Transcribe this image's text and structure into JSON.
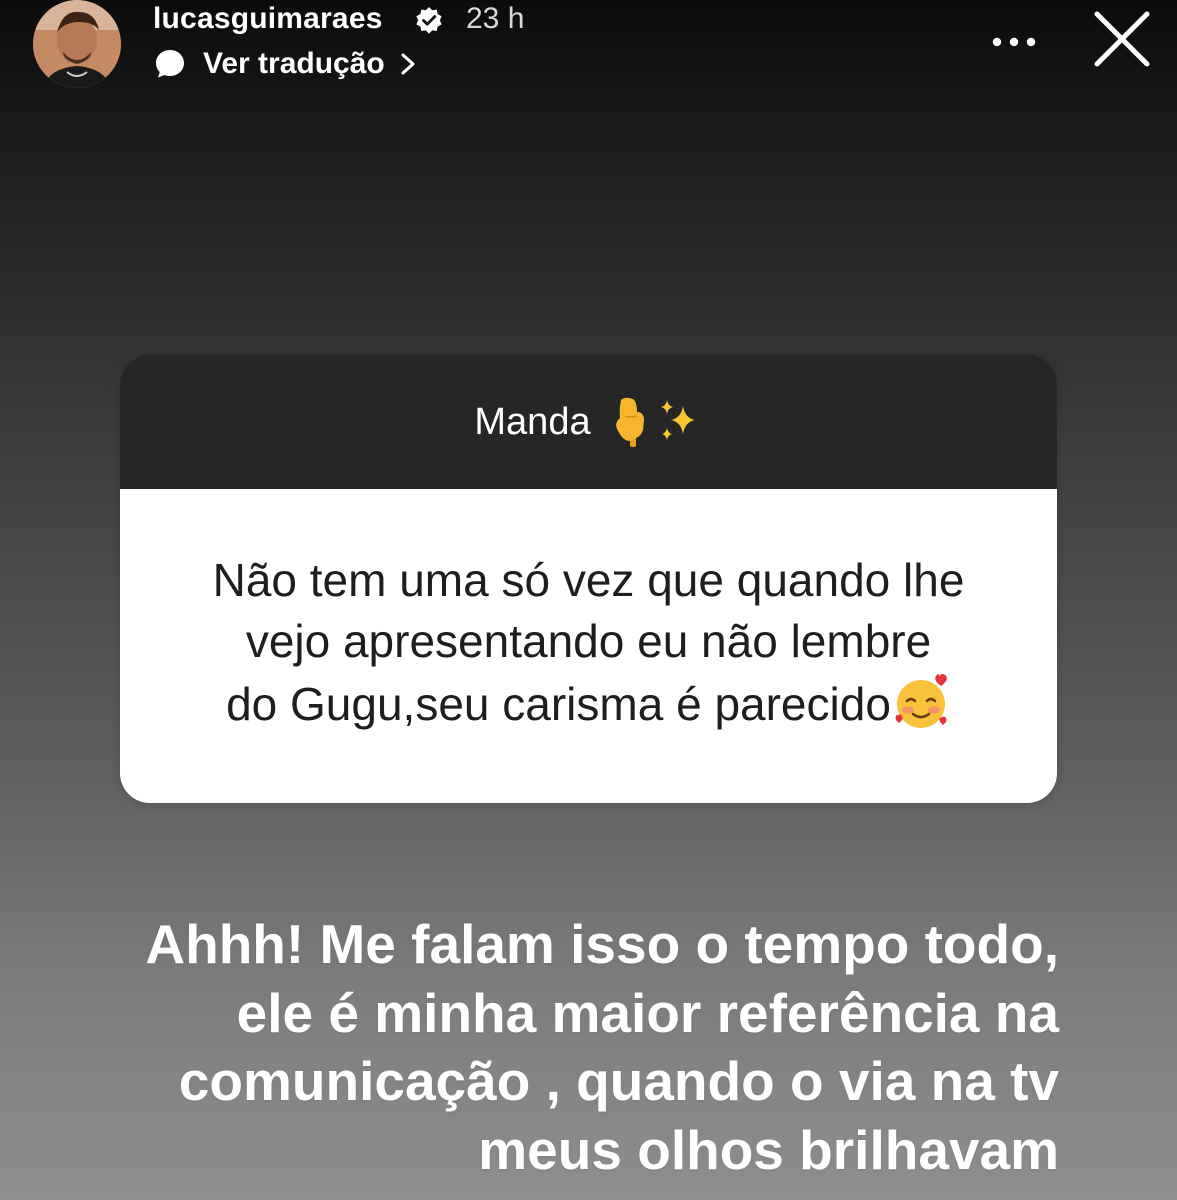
{
  "header": {
    "username": "lucasguimaraes",
    "verified_icon": "verified-badge-icon",
    "time": "23 h",
    "translate_label": "Ver tradução",
    "translate_icon": "speech-bubble-icon",
    "more_icon": "more-options-icon",
    "close_icon": "close-icon"
  },
  "question_sticker": {
    "title": "Manda",
    "title_emojis": [
      "pointing-down-emoji",
      "sparkles-emoji"
    ],
    "header_color": "#262626",
    "body_color": "#ffffff",
    "question_lines": [
      "Não tem uma só vez que quando lhe",
      "vejo apresentando eu não lembre",
      "do Gugu,seu carisma é parecido"
    ],
    "trailing_emoji": "smiling-face-with-hearts-emoji"
  },
  "answer": {
    "lines": [
      "Ahhh! Me falam isso o tempo todo,",
      "ele é minha maior referência na",
      "comunicação , quando o via na tv",
      "meus olhos brilhavam"
    ]
  }
}
